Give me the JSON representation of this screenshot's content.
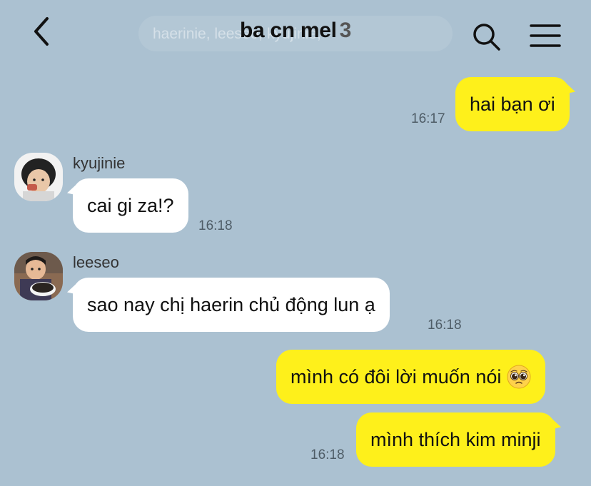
{
  "header": {
    "title": "ba cn mel",
    "member_count": "3",
    "members_preview": "haerinie, leeseo, kyujinie,"
  },
  "messages": [
    {
      "id": "m1",
      "from": "me",
      "text": "hai bạn ơi",
      "time": "16:17"
    },
    {
      "id": "m2",
      "from": "kyujinie",
      "sender": "kyujinie",
      "text": "cai gi za!?",
      "time": "16:18"
    },
    {
      "id": "m3",
      "from": "leeseo",
      "sender": "leeseo",
      "text": "sao nay chị haerin chủ động lun ạ",
      "time": "16:18"
    },
    {
      "id": "m4",
      "from": "me",
      "text": "mình có đôi lời muốn nói",
      "emoji": "pleading-face-emoji",
      "time": ""
    },
    {
      "id": "m5",
      "from": "me",
      "text": "mình thích kim minji",
      "time": "16:18"
    }
  ],
  "colors": {
    "background": "#abc1d1",
    "my_bubble": "#fef01b",
    "other_bubble": "#ffffff"
  },
  "icons": [
    "chevron-left-icon",
    "search-icon",
    "hamburger-menu-icon"
  ]
}
